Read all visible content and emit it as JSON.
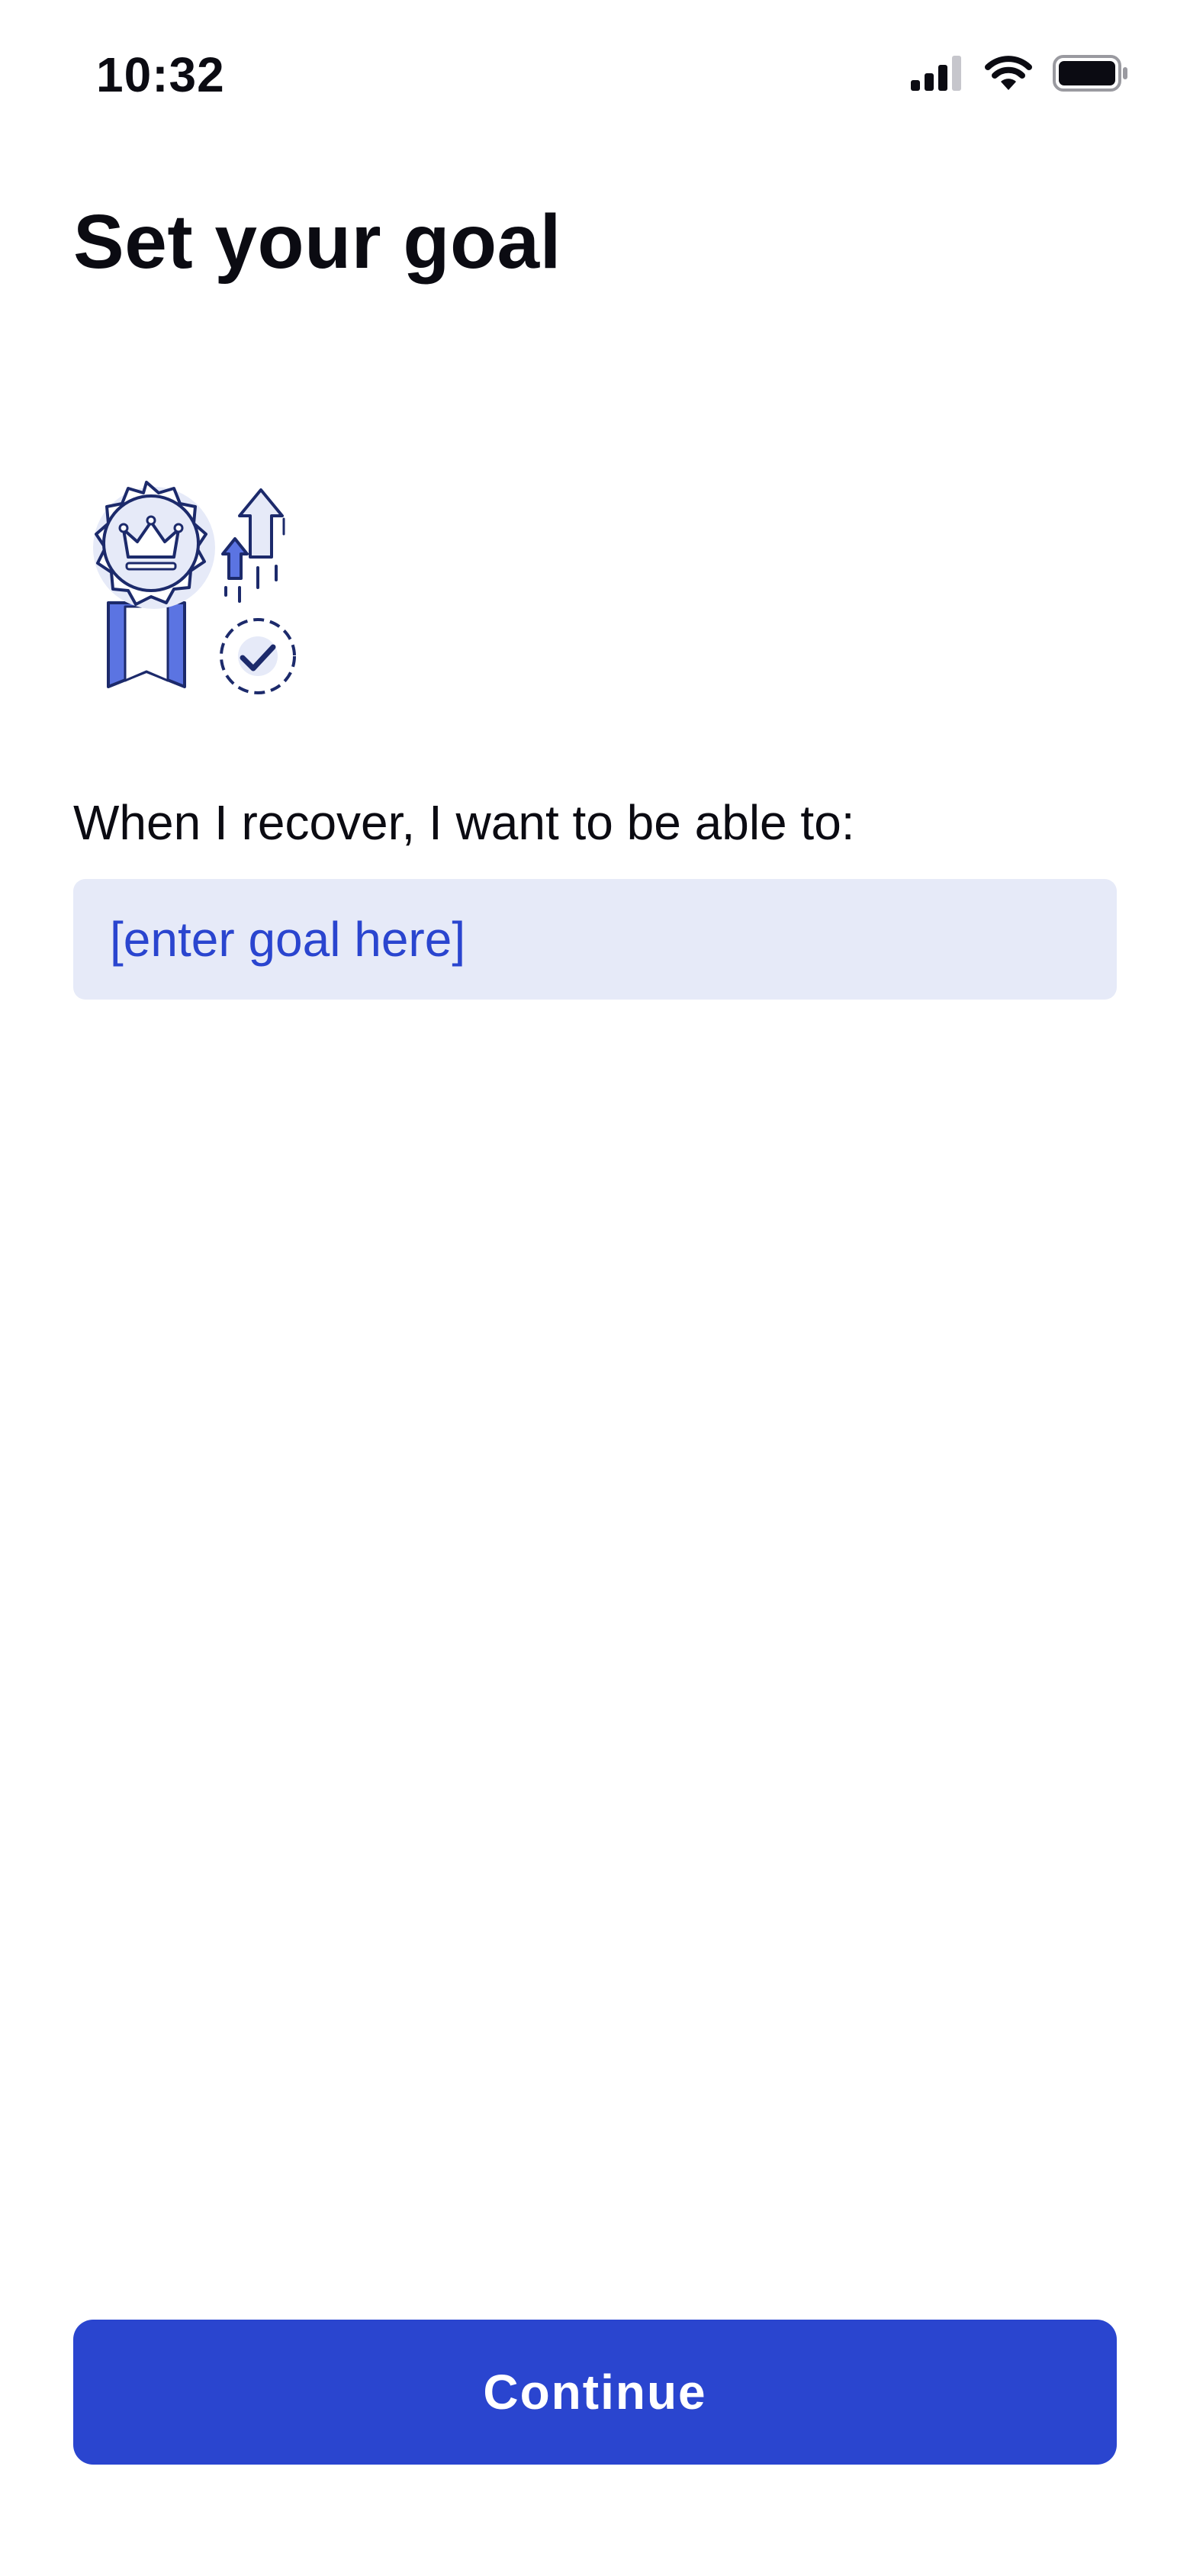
{
  "status_bar": {
    "time": "10:32",
    "icons": [
      "cellular-signal-icon",
      "wifi-icon",
      "battery-icon"
    ]
  },
  "page": {
    "title": "Set your goal"
  },
  "illustration": {
    "icon": "award-ribbon-crown-icon",
    "colors": {
      "accent": "#5b74e2",
      "outline": "#1c2a6b",
      "fill": "#e6eaf8"
    }
  },
  "goal_form": {
    "prompt": "When I recover, I want to be able to:",
    "input_value": "",
    "input_placeholder": "[enter goal here]"
  },
  "footer": {
    "continue_label": "Continue"
  },
  "colors": {
    "primary": "#2a45cf",
    "input_background": "#e6eaf8",
    "text": "#0b0b12",
    "background": "#ffffff"
  }
}
